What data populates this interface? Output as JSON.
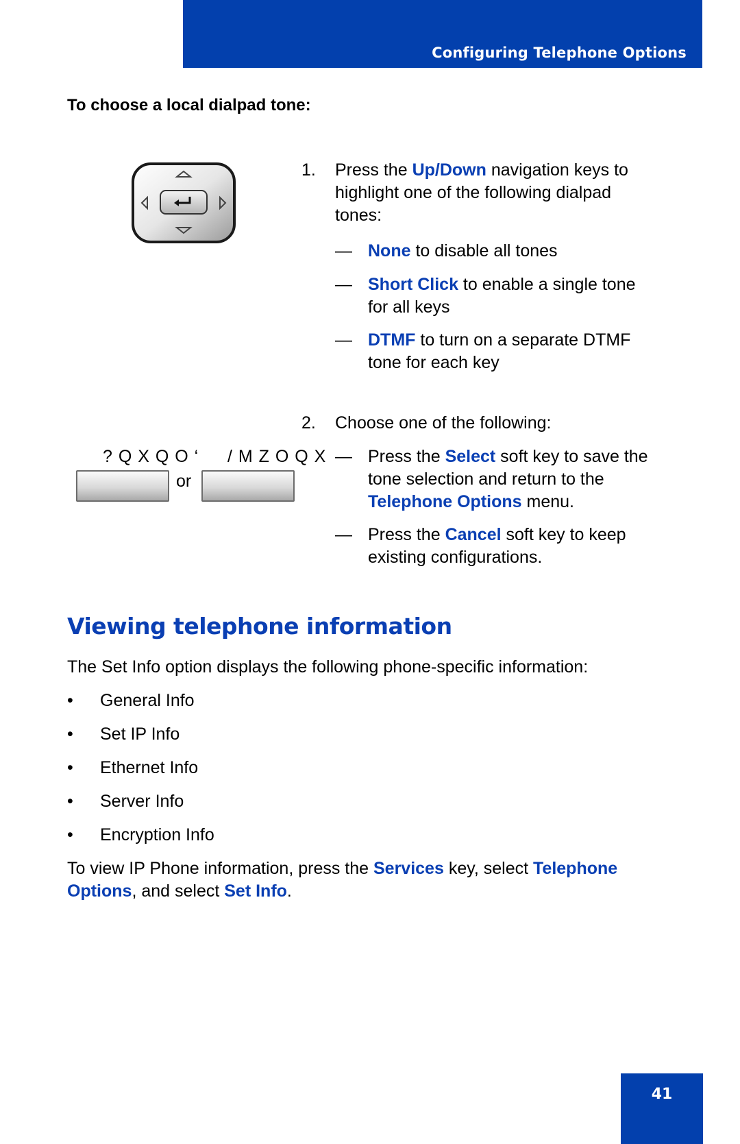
{
  "header": {
    "title": "Configuring Telephone Options"
  },
  "procedure": {
    "heading": "To choose a local dialpad tone:",
    "step1": {
      "number": "1.",
      "line1_pre": "Press the ",
      "line1_key": "Up/Down",
      "line1_post": " navigation keys to",
      "line2": "highlight one of the following dialpad",
      "line3": "tones:",
      "options": [
        {
          "dash": "—",
          "key": "None",
          "text": " to disable all tones",
          "text2": ""
        },
        {
          "dash": "—",
          "key": "Short Click",
          "text": " to enable a single tone",
          "text2": "for all keys"
        },
        {
          "dash": "—",
          "key": "DTMF",
          "text": " to turn on a separate DTMF",
          "text2": "tone for each key"
        }
      ]
    },
    "step2": {
      "number": "2.",
      "text": "Choose one of the following:",
      "options": [
        {
          "dash": "—",
          "pre": "Press the ",
          "key": "Select",
          "post": " soft key to save the",
          "line2": "tone selection and return to the",
          "key2": "Telephone Options",
          "post2": " menu."
        },
        {
          "dash": "—",
          "pre": "Press the ",
          "key": "Cancel",
          "post": " soft key to keep",
          "line2": "existing configurations."
        }
      ]
    },
    "softkeys": {
      "left_label": "? Q X Q O ‘",
      "right_label": "/ M Z O Q X",
      "or": "or"
    },
    "nav_cluster": {
      "icon": "navigation-cluster-icon",
      "center": "↵"
    }
  },
  "section": {
    "title": "Viewing telephone information",
    "intro": "The Set Info option displays the following phone-specific information:",
    "bullet_char": "•",
    "items": [
      "General Info",
      "Set IP Info",
      "Ethernet Info",
      "Server Info",
      "Encryption Info"
    ],
    "footer": {
      "pre": "To view IP Phone information, press the ",
      "key1": "Services",
      "mid": " key, select ",
      "key2a": "Telephone",
      "key2b": "Options",
      "mid2": ", and select ",
      "key3": "Set Info",
      "end": "."
    }
  },
  "page": {
    "number": "41"
  },
  "colors": {
    "brand_blue": "#0340ad",
    "link_blue": "#0a3fb3"
  }
}
